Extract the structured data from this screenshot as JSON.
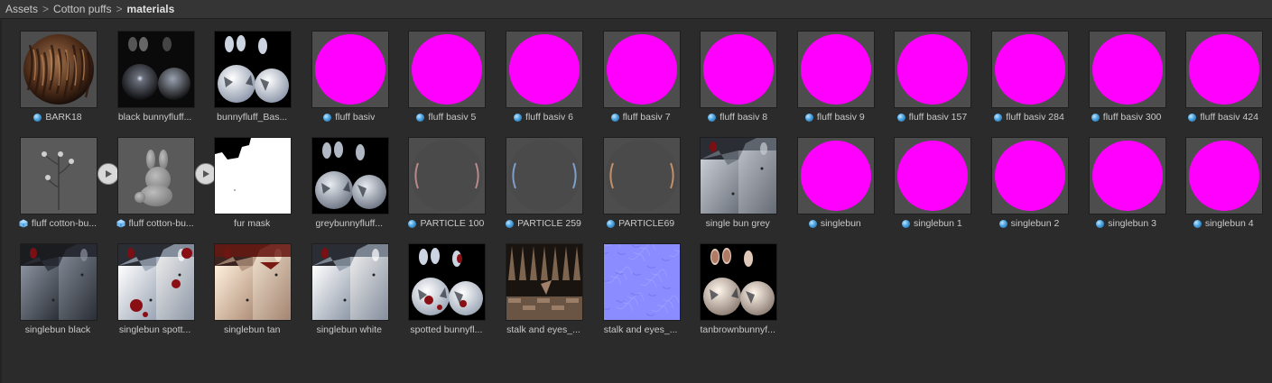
{
  "breadcrumb": {
    "items": [
      "Assets",
      "Cotton puffs",
      "materials"
    ],
    "separator": ">"
  },
  "colors": {
    "missing_shader": "#ff00ff",
    "background": "#2b2b2b",
    "thumb_bg": "#4d4d4d"
  },
  "assets": [
    {
      "label": "BARK18",
      "type": "material",
      "thumb": "bark"
    },
    {
      "label": "black bunnyfluff...",
      "type": "none",
      "thumb": "black-bunny"
    },
    {
      "label": "bunnyfluff_Bas...",
      "type": "none",
      "thumb": "bunny-white"
    },
    {
      "label": "fluff basiv",
      "type": "material",
      "thumb": "magenta"
    },
    {
      "label": "fluff basiv 5",
      "type": "material",
      "thumb": "magenta"
    },
    {
      "label": "fluff basiv 6",
      "type": "material",
      "thumb": "magenta"
    },
    {
      "label": "fluff basiv 7",
      "type": "material",
      "thumb": "magenta"
    },
    {
      "label": "fluff basiv 8",
      "type": "material",
      "thumb": "magenta"
    },
    {
      "label": "fluff basiv 9",
      "type": "material",
      "thumb": "magenta"
    },
    {
      "label": "fluff basiv 157",
      "type": "material",
      "thumb": "magenta"
    },
    {
      "label": "fluff basiv 284",
      "type": "material",
      "thumb": "magenta"
    },
    {
      "label": "fluff basiv 300",
      "type": "material",
      "thumb": "magenta"
    },
    {
      "label": "fluff basiv 424",
      "type": "material",
      "thumb": "magenta"
    },
    {
      "label": "fluff cotton-bu...",
      "type": "prefab",
      "thumb": "stalk-prefab",
      "play": true
    },
    {
      "label": "fluff cotton-bu...",
      "type": "prefab",
      "thumb": "bunny-prefab",
      "play": true
    },
    {
      "label": "fur mask",
      "type": "none",
      "thumb": "fur-mask"
    },
    {
      "label": "greybunnyfluff...",
      "type": "none",
      "thumb": "bunny-grey"
    },
    {
      "label": "PARTICLE 100",
      "type": "material",
      "thumb": "particle-pink"
    },
    {
      "label": "PARTICLE 259",
      "type": "material",
      "thumb": "particle-blue"
    },
    {
      "label": "PARTICLE69",
      "type": "material",
      "thumb": "particle-orange"
    },
    {
      "label": "single bun grey",
      "type": "none",
      "thumb": "single-bun-grey"
    },
    {
      "label": "singlebun",
      "type": "material",
      "thumb": "magenta"
    },
    {
      "label": "singlebun 1",
      "type": "material",
      "thumb": "magenta"
    },
    {
      "label": "singlebun 2",
      "type": "material",
      "thumb": "magenta"
    },
    {
      "label": "singlebun 3",
      "type": "material",
      "thumb": "magenta"
    },
    {
      "label": "singlebun 4",
      "type": "material",
      "thumb": "magenta"
    },
    {
      "label": "singlebun black",
      "type": "none",
      "thumb": "singlebun-black"
    },
    {
      "label": "singlebun spott...",
      "type": "none",
      "thumb": "singlebun-spotted"
    },
    {
      "label": "singlebun tan",
      "type": "none",
      "thumb": "singlebun-tan"
    },
    {
      "label": "singlebun white",
      "type": "none",
      "thumb": "singlebun-white"
    },
    {
      "label": "spotted bunnyfl...",
      "type": "none",
      "thumb": "spotted-bunny"
    },
    {
      "label": "stalk and eyes_...",
      "type": "none",
      "thumb": "stalk-texture"
    },
    {
      "label": "stalk and eyes_...",
      "type": "none",
      "thumb": "normal-map"
    },
    {
      "label": "tanbrownbunnyf...",
      "type": "none",
      "thumb": "tan-bunny"
    }
  ]
}
